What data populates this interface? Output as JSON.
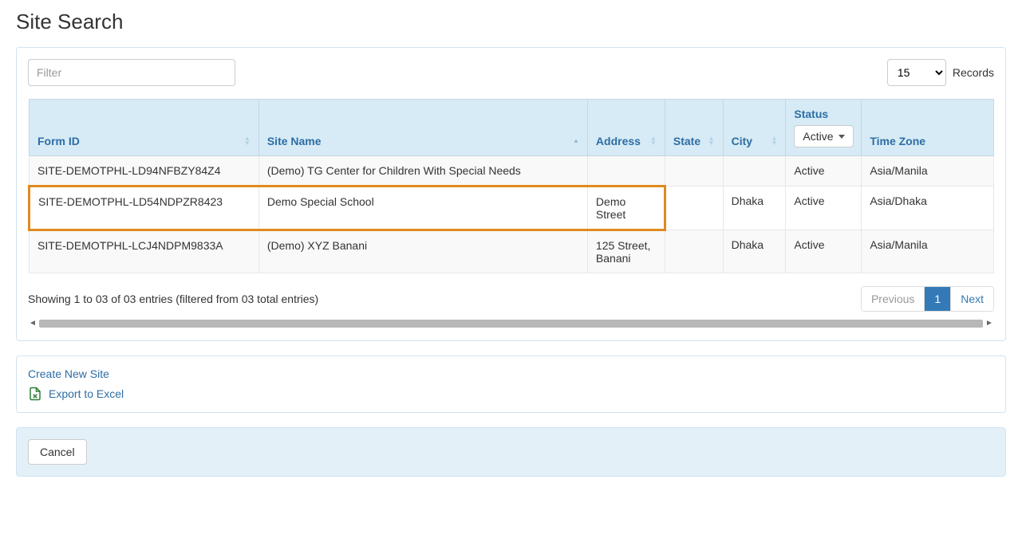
{
  "page": {
    "title": "Site Search"
  },
  "filter": {
    "placeholder": "Filter",
    "value": ""
  },
  "records": {
    "selected": "15",
    "label": "Records"
  },
  "table": {
    "headers": {
      "form_id": "Form ID",
      "site_name": "Site Name",
      "address": "Address",
      "state": "State",
      "city": "City",
      "status": "Status",
      "time_zone": "Time Zone"
    },
    "status_filter_selected": "Active",
    "rows": [
      {
        "form_id": "SITE-DEMOTPHL-LD94NFBZY84Z4",
        "site_name": "(Demo) TG Center for Children With Special Needs",
        "address": "",
        "state": "",
        "city": "",
        "status": "Active",
        "time_zone": "Asia/Manila",
        "highlighted": false
      },
      {
        "form_id": "SITE-DEMOTPHL-LD54NDPZR8423",
        "site_name": "Demo Special School",
        "address": "Demo Street",
        "state": "",
        "city": "Dhaka",
        "status": "Active",
        "time_zone": "Asia/Dhaka",
        "highlighted": true
      },
      {
        "form_id": "SITE-DEMOTPHL-LCJ4NDPM9833A",
        "site_name": "(Demo) XYZ Banani",
        "address": "125 Street, Banani",
        "state": "",
        "city": "Dhaka",
        "status": "Active",
        "time_zone": "Asia/Manila",
        "highlighted": false
      }
    ]
  },
  "info_text": "Showing 1 to 03 of 03 entries (filtered from 03 total entries)",
  "pager": {
    "previous": "Previous",
    "next": "Next",
    "current": "1"
  },
  "actions": {
    "create_new_site": "Create New Site",
    "export_excel": "Export to Excel",
    "cancel": "Cancel"
  }
}
